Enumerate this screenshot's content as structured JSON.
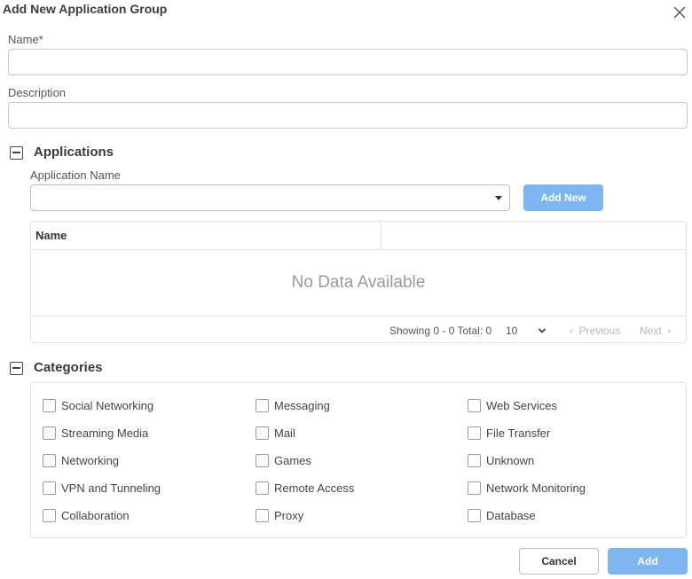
{
  "dialog": {
    "title": "Add New Application Group"
  },
  "form": {
    "name_label": "Name*",
    "name_value": "",
    "description_label": "Description",
    "description_value": ""
  },
  "applications": {
    "section_title": "Applications",
    "app_name_label": "Application Name",
    "selected_value": "",
    "add_new_label": "Add New",
    "table": {
      "columns": [
        "Name",
        ""
      ],
      "empty_text": "No Data Available",
      "showing_text": "Showing 0 - 0 Total: 0",
      "page_size": "10",
      "previous_label": "Previous",
      "next_label": "Next"
    }
  },
  "categories": {
    "section_title": "Categories",
    "items": [
      "Social Networking",
      "Messaging",
      "Web Services",
      "Streaming Media",
      "Mail",
      "File Transfer",
      "Networking",
      "Games",
      "Unknown",
      "VPN and Tunneling",
      "Remote Access",
      "Network Monitoring",
      "Collaboration",
      "Proxy",
      "Database"
    ]
  },
  "footer": {
    "cancel_label": "Cancel",
    "add_label": "Add"
  },
  "colors": {
    "primary_button": "#7db5f1"
  }
}
